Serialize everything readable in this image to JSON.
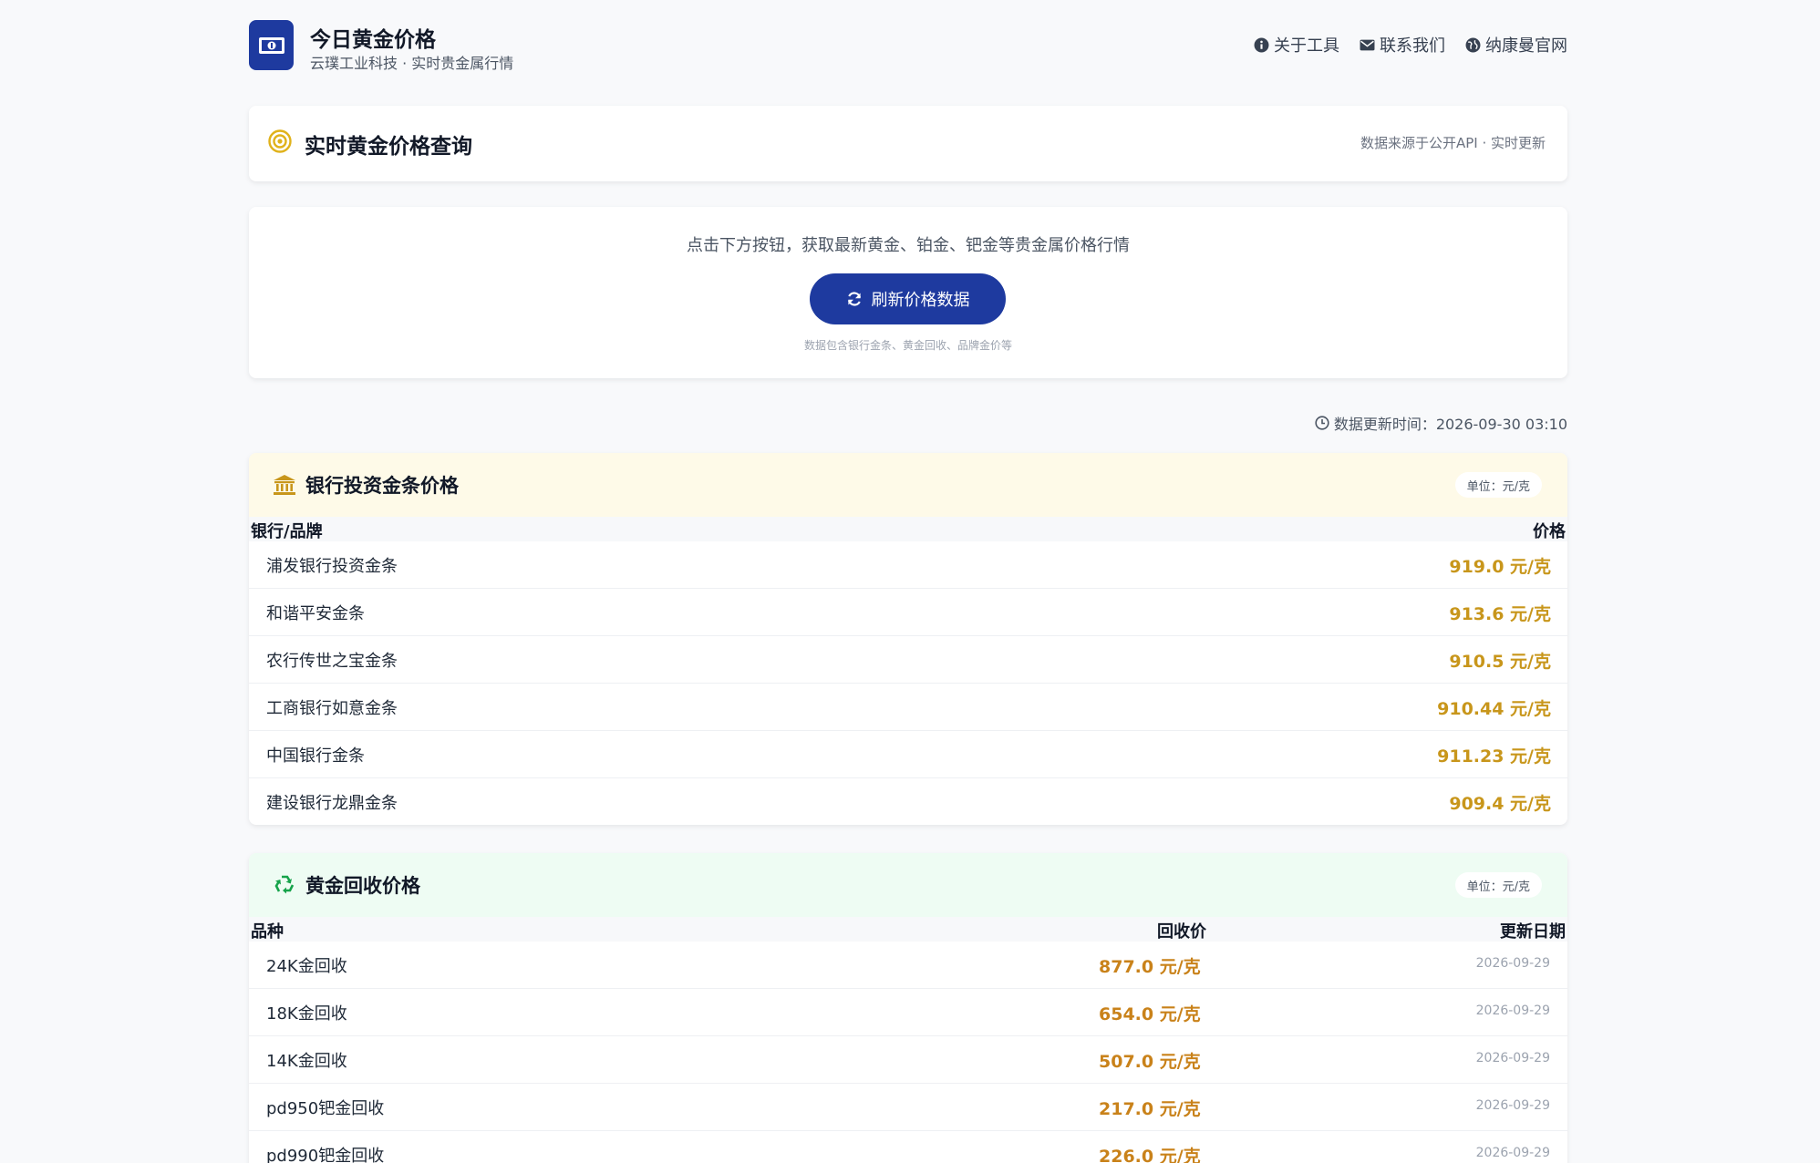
{
  "header": {
    "title": "今日黄金价格",
    "subtitle": "云璞工业科技 · 实时贵金属行情",
    "nav": [
      {
        "label": "关于工具",
        "icon": "info-icon"
      },
      {
        "label": "联系我们",
        "icon": "envelope-icon"
      },
      {
        "label": "纳康曼官网",
        "icon": "globe-icon"
      }
    ]
  },
  "title_card": {
    "title": "实时黄金价格查询",
    "source": "数据来源于公开API · 实时更新"
  },
  "refresh_card": {
    "description": "点击下方按钮，获取最新黄金、铂金、钯金等贵金属价格行情",
    "button_label": "刷新价格数据",
    "note": "数据包含银行金条、黄金回收、品牌金价等"
  },
  "update_time": "数据更新时间：2026-09-30 03:10",
  "bank_table": {
    "title": "银行投资金条价格",
    "unit": "单位：元/克",
    "columns": [
      "银行/品牌",
      "价格"
    ],
    "rows": [
      {
        "name": "浦发银行投资金条",
        "price": "919.0 元/克"
      },
      {
        "name": "和谐平安金条",
        "price": "913.6 元/克"
      },
      {
        "name": "农行传世之宝金条",
        "price": "910.5 元/克"
      },
      {
        "name": "工商银行如意金条",
        "price": "910.44 元/克"
      },
      {
        "name": "中国银行金条",
        "price": "911.23 元/克"
      },
      {
        "name": "建设银行龙鼎金条",
        "price": "909.4 元/克"
      }
    ]
  },
  "recycle_table": {
    "title": "黄金回收价格",
    "unit": "单位：元/克",
    "columns": [
      "品种",
      "回收价",
      "更新日期"
    ],
    "rows": [
      {
        "name": "24K金回收",
        "price": "877.0 元/克",
        "date": "2026-09-29"
      },
      {
        "name": "18K金回收",
        "price": "654.0 元/克",
        "date": "2026-09-29"
      },
      {
        "name": "14K金回收",
        "price": "507.0 元/克",
        "date": "2026-09-29"
      },
      {
        "name": "pd950钯金回收",
        "price": "217.0 元/克",
        "date": "2026-09-29"
      },
      {
        "name": "pd990钯金回收",
        "price": "226.0 元/克",
        "date": "2026-09-29"
      }
    ]
  },
  "colors": {
    "brand_blue": "#1e3a9f",
    "gold_price": "#c8961b",
    "recycle_price": "#c9821a",
    "bank_header_bg": "#fefae8",
    "recycle_header_bg": "#eefcf3"
  }
}
